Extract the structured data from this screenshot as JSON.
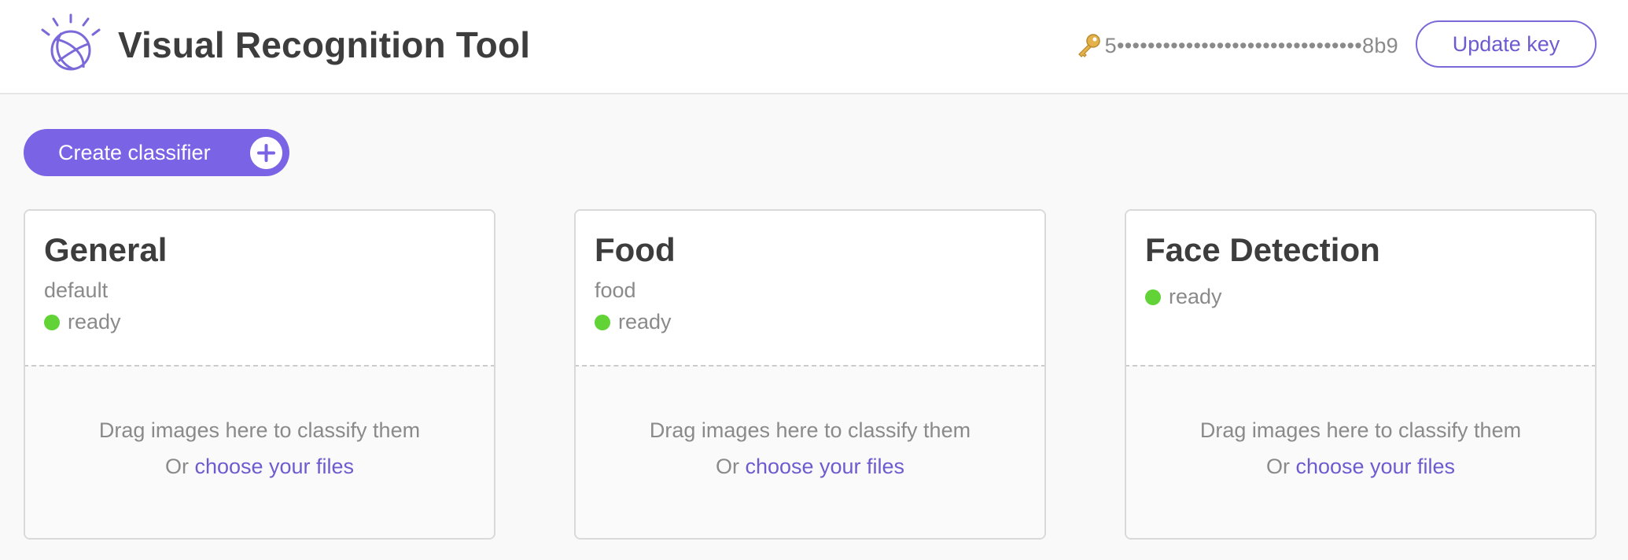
{
  "header": {
    "title": "Visual Recognition Tool",
    "api_key_masked": "5••••••••••••••••••••••••••••••••8b9",
    "update_key_label": "Update key"
  },
  "toolbar": {
    "create_label": "Create classifier"
  },
  "classifiers": [
    {
      "name": "General",
      "id": "default",
      "status": "ready",
      "drop_text": "Drag images here to classify them",
      "or_text": "Or ",
      "choose_text": "choose your files"
    },
    {
      "name": "Food",
      "id": "food",
      "status": "ready",
      "drop_text": "Drag images here to classify them",
      "or_text": "Or ",
      "choose_text": "choose your files"
    },
    {
      "name": "Face Detection",
      "status": "ready",
      "drop_text": "Drag images here to classify them",
      "or_text": "Or ",
      "choose_text": "choose your files"
    }
  ],
  "icons": {
    "logo": "ibm-watson-logo-icon",
    "key": "key-icon",
    "plus": "plus-icon",
    "status": "status-dot"
  },
  "colors": {
    "accent": "#7b63e6",
    "link": "#6d5bd0",
    "status_ready": "#62d337",
    "key_gold": "#d9a531"
  }
}
